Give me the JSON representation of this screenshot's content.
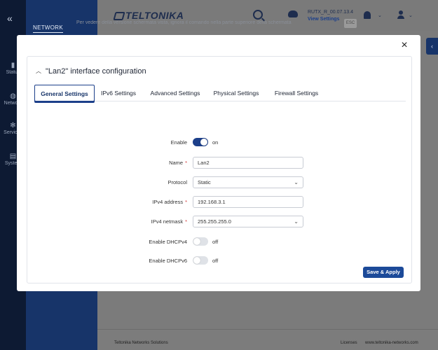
{
  "app": {
    "brand": "TELTONIKA",
    "firmware": "RUTX_R_00.07.13.4",
    "view_settings": "View Settings",
    "notice": "Per vedere della versione schermata vista, ignora il comando nella parte superiore della schermata",
    "esc": "ESC"
  },
  "sidebar": {
    "collapse_glyph": "«",
    "items": [
      {
        "label": "Status",
        "icon": "chart-icon"
      },
      {
        "label": "Network",
        "icon": "globe-icon"
      },
      {
        "label": "Services",
        "icon": "gear-icon"
      },
      {
        "label": "System",
        "icon": "file-icon"
      }
    ]
  },
  "subnav": {
    "title": "NETWORK"
  },
  "footer": {
    "company": "Teltonika Networks Solutions",
    "licenses": "Licenses",
    "website": "www.teltonika-networks.com"
  },
  "modal": {
    "close": "×",
    "title": "\"Lan2\" interface configuration",
    "tabs": [
      {
        "label": "General Settings",
        "active": true
      },
      {
        "label": "IPv6 Settings",
        "active": false
      },
      {
        "label": "Advanced Settings",
        "active": false
      },
      {
        "label": "Physical Settings",
        "active": false
      },
      {
        "label": "Firewall Settings",
        "active": false
      }
    ],
    "form": {
      "enable": {
        "label": "Enable",
        "state": "on"
      },
      "name": {
        "label": "Name",
        "value": "Lan2"
      },
      "protocol": {
        "label": "Protocol",
        "value": "Static"
      },
      "ipv4_address": {
        "label": "IPv4 address",
        "value": "192.168.3.1"
      },
      "ipv4_netmask": {
        "label": "IPv4 netmask",
        "value": "255.255.255.0"
      },
      "dhcpv4": {
        "label": "Enable DHCPv4",
        "state": "off"
      },
      "dhcpv6": {
        "label": "Enable DHCPv6",
        "state": "off"
      }
    },
    "save_label": "Save & Apply"
  },
  "colors": {
    "accent": "#1c3f8a",
    "sidebar": "#0d1a33",
    "subnav": "#173469",
    "required": "#d23b3b"
  }
}
